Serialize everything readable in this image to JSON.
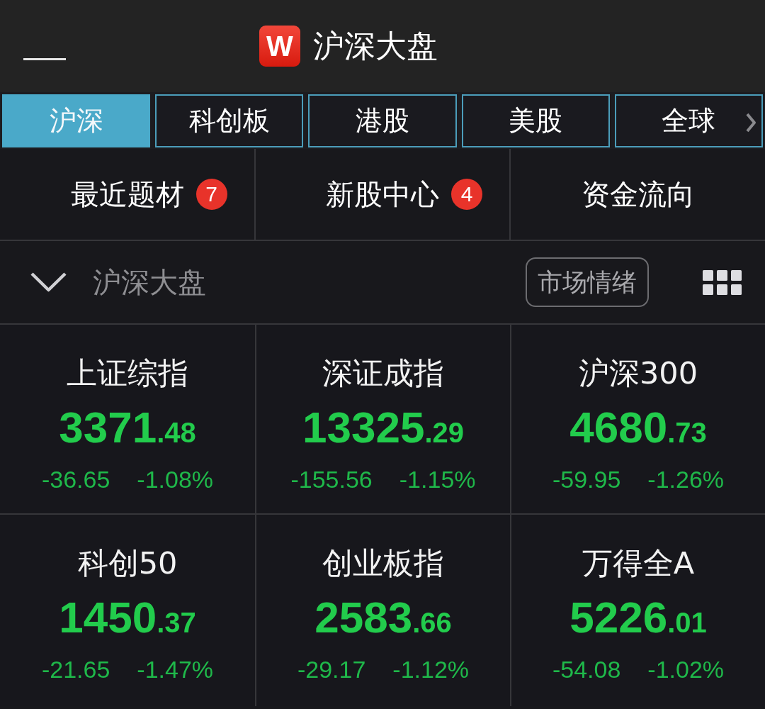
{
  "header": {
    "logo": "W",
    "title": "沪深大盘"
  },
  "market_tabs": [
    {
      "label": "沪深",
      "selected": true
    },
    {
      "label": "科创板",
      "selected": false
    },
    {
      "label": "港股",
      "selected": false
    },
    {
      "label": "美股",
      "selected": false
    },
    {
      "label": "全球",
      "selected": false
    }
  ],
  "shortcuts": [
    {
      "label": "最近题材",
      "badge": "7"
    },
    {
      "label": "新股中心",
      "badge": "4"
    },
    {
      "label": "资金流向"
    }
  ],
  "section": {
    "title": "沪深大盘",
    "expanded": true,
    "button": "市场情绪"
  },
  "indices": [
    {
      "name": "上证综指",
      "value": "3371.48",
      "change": "-36.65",
      "change_percent": "-1.08%",
      "falling": true
    },
    {
      "name": "深证成指",
      "value": "13325.29",
      "change": "-155.56",
      "change_percent": "-1.15%",
      "falling": true
    },
    {
      "name": "沪深300",
      "value": "4680.73",
      "change": "-59.95",
      "change_percent": "-1.26%",
      "falling": true
    },
    {
      "name": "科创50",
      "value": "1450.37",
      "change": "-21.65",
      "change_percent": "-1.47%",
      "falling": true
    },
    {
      "name": "创业板指",
      "value": "2583.66",
      "change": "-29.17",
      "change_percent": "-1.12%",
      "falling": true
    },
    {
      "name": "万得全A",
      "value": "5226.01",
      "change": "-54.08",
      "change_percent": "-1.02%",
      "falling": true
    }
  ]
}
